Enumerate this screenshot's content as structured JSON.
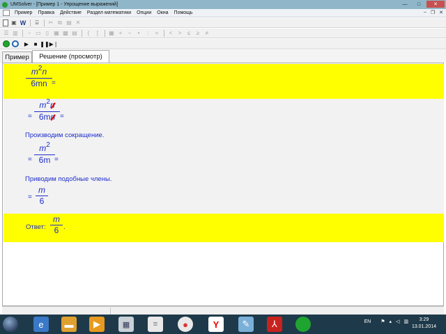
{
  "window": {
    "title": "UMSolver - [Пример 1 - Упрощение выражений]"
  },
  "window_buttons": {
    "minimize": "—",
    "maximize": "□",
    "close": "✕"
  },
  "menu": [
    "Пример",
    "Правка",
    "Действие",
    "Раздел математики",
    "Опции",
    "Окна",
    "Помощь"
  ],
  "mdi_buttons": {
    "minimize": "–",
    "restore": "❐",
    "close": "✕"
  },
  "toolbar1": {
    "word_label": "W"
  },
  "toolbar2_symbols": [
    "(",
    "[",
    "+",
    "−",
    "•",
    ":",
    "=",
    "<",
    ">",
    "≤",
    "≥",
    "≠"
  ],
  "toolbar3": {
    "play": "▶",
    "stop": "■",
    "pause": "❚❚",
    "step": "▶❘"
  },
  "tabs": [
    {
      "label": "Пример",
      "active": false
    },
    {
      "label": "Решение (просмотр)",
      "active": true
    }
  ],
  "solution": {
    "step0": {
      "num_base": "m",
      "num_exp": "2",
      "num_var": "n",
      "den": "6mn",
      "eq": "="
    },
    "step1": {
      "lead_eq": "=",
      "num_base": "m",
      "num_exp": "2",
      "num_var": "n",
      "den_a": "6m",
      "den_b": "n",
      "eq": "="
    },
    "text1": "Производим сокращение.",
    "step2": {
      "lead_eq": "=",
      "num_base": "m",
      "num_exp": "2",
      "den": "6m",
      "eq": "="
    },
    "text2": "Приводим подобные члены.",
    "step3": {
      "lead_eq": "=",
      "num": "m",
      "den": "6"
    },
    "answer": {
      "label": "Ответ:",
      "num": "m",
      "den": "6",
      "end": "."
    }
  },
  "colors": {
    "highlight": "#ffff00",
    "math": "#1f2ec9",
    "cancel": "#e00000"
  },
  "taskbar": {
    "language": "EN",
    "time": "3:29",
    "date": "13.01.2014",
    "apps": [
      "ie-icon",
      "folder-icon",
      "media-player-icon",
      "calculator-icon",
      "notepad-icon",
      "chrome-icon",
      "yandex-icon",
      "paint-icon",
      "pdf-icon",
      "umsolver-icon"
    ]
  }
}
